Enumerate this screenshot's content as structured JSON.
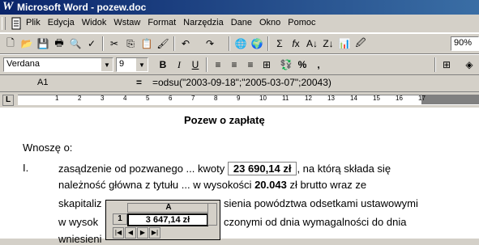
{
  "window": {
    "title": "Microsoft Word - pozew.doc"
  },
  "menu": {
    "items": [
      "Plik",
      "Edycja",
      "Widok",
      "Wstaw",
      "Format",
      "Narzędzia",
      "Dane",
      "Okno",
      "Pomoc"
    ]
  },
  "toolbar": {
    "zoom": "90%"
  },
  "formatting": {
    "font": "Verdana",
    "size": "9"
  },
  "formula_bar": {
    "cell_ref": "A1",
    "eq": "=",
    "formula": "=odsu(\"2003-09-18\";\"2005-03-07\";20043)"
  },
  "ruler": {
    "numbers": [
      "1",
      "2",
      "3",
      "4",
      "5",
      "6",
      "7",
      "8",
      "9",
      "10",
      "11",
      "12",
      "13",
      "14",
      "15",
      "16",
      "17"
    ]
  },
  "document": {
    "heading": "Pozew o zapłatę",
    "wnosze": "Wnoszę o:",
    "item_num": "I.",
    "line1_a": "zasądzenie od pozwanego ... kwoty",
    "amount": "23 690,14 zł",
    "line1_b": ", na którą składa się",
    "line2_a": "należność główna z tytułu ... w wysokości",
    "principal": "20.043",
    "line2_b": "zł brutto wraz ze",
    "line3_a": "skapitaliz",
    "line3_b": "sienia powództwa odsetkami ustawowymi",
    "line4_a": "w wysok",
    "line4_b": "czonymi od dnia wymagalności do dnia",
    "line5_a": "wniesieni"
  },
  "excel_object": {
    "col": "A",
    "row": "1",
    "value": "3 647,14 zł"
  }
}
